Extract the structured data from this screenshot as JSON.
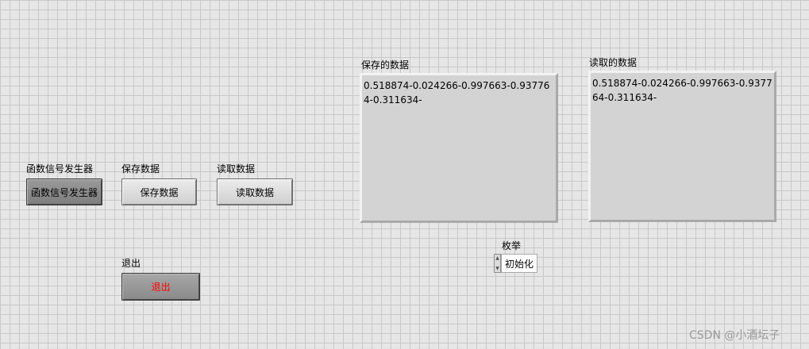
{
  "controls": {
    "generator": {
      "label": "函数信号发生器",
      "button_text": "函数信号发生器"
    },
    "save": {
      "label": "保存数据",
      "button_text": "保存数据"
    },
    "read": {
      "label": "读取数据",
      "button_text": "读取数据"
    },
    "exit": {
      "label": "退出",
      "button_text": "退出",
      "text_color": "#ff0000"
    }
  },
  "indicators": {
    "saved": {
      "label": "保存的数据",
      "value": "0.518874-0.024266-0.997663-0.937764-0.311634-"
    },
    "read": {
      "label": "读取的数据",
      "value": "0.518874-0.024266-0.997663-0.937764-0.311634-"
    }
  },
  "enum": {
    "label": "枚举",
    "value": "初始化"
  },
  "watermark": "CSDN @小酒坛子"
}
